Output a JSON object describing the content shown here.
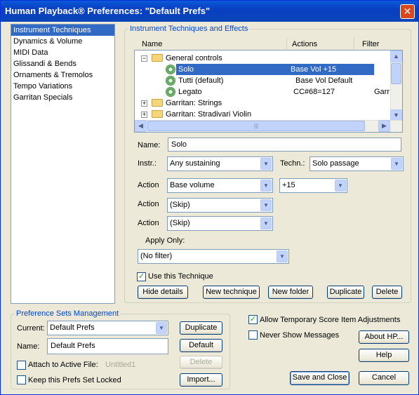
{
  "window": {
    "title": "Human Playback® Preferences: \"Default Prefs\"",
    "close_glyph": "✕"
  },
  "sidebar": {
    "items": [
      {
        "label": "Instrument Techniques",
        "selected": true
      },
      {
        "label": "Dynamics & Volume"
      },
      {
        "label": "MIDI Data"
      },
      {
        "label": "Glissandi & Bends"
      },
      {
        "label": "Ornaments & Tremolos"
      },
      {
        "label": "Tempo Variations"
      },
      {
        "label": "Garritan Specials"
      }
    ]
  },
  "techniques": {
    "group_title": "Instrument Techniques and Effects",
    "columns": {
      "name": "Name",
      "actions": "Actions",
      "filter": "Filter"
    },
    "tree": {
      "general": "General controls",
      "solo": {
        "name": "Solo",
        "action": "Base Vol +15"
      },
      "tutti": {
        "name": "Tutti (default)",
        "action": "Base Vol Default"
      },
      "legato": {
        "name": "Legato",
        "action": "CC#68=127",
        "filter": "Garr"
      },
      "strings": "Garritan: Strings",
      "stradivari": "Garritan: Stradivari Violin"
    },
    "name_label": "Name:",
    "name_value": "Solo",
    "instr_label": "Instr.:",
    "instr_value": "Any sustaining",
    "techn_label": "Techn.:",
    "techn_value": "Solo passage",
    "action_label": "Action",
    "action1_value": "Base volume",
    "action1_amount": "+15",
    "action2_value": "(Skip)",
    "action3_value": "(Skip)",
    "apply_only_label": "Apply Only:",
    "apply_only_value": "(No filter)",
    "use_technique_label": "Use this Technique",
    "use_technique_checked": true,
    "buttons": {
      "hide_details": "Hide details",
      "new_technique": "New technique",
      "new_folder": "New folder",
      "duplicate": "Duplicate",
      "delete": "Delete"
    }
  },
  "pref_sets": {
    "group_title": "Preference Sets Management",
    "current_label": "Current:",
    "current_value": "Default Prefs",
    "name_label": "Name:",
    "name_value": "Default Prefs",
    "buttons": {
      "duplicate": "Duplicate",
      "default": "Default",
      "delete": "Delete",
      "import": "Import..."
    },
    "attach_label": "Attach to Active File:",
    "attach_file": "Untitled1",
    "keep_locked_label": "Keep this Prefs Set Locked"
  },
  "options": {
    "allow_temp_label": "Allow Temporary Score Item Adjustments",
    "allow_temp_checked": true,
    "never_show_label": "Never Show Messages"
  },
  "footer": {
    "about": "About HP...",
    "help": "Help",
    "save_close": "Save and Close",
    "cancel": "Cancel"
  },
  "icons": {
    "check": "✓",
    "dropdown": "▼",
    "expand_minus": "−",
    "expand_plus": "+",
    "scroll_up": "▲",
    "scroll_down": "▼",
    "scroll_left": "◀",
    "scroll_right": "▶",
    "grip": "|||"
  }
}
